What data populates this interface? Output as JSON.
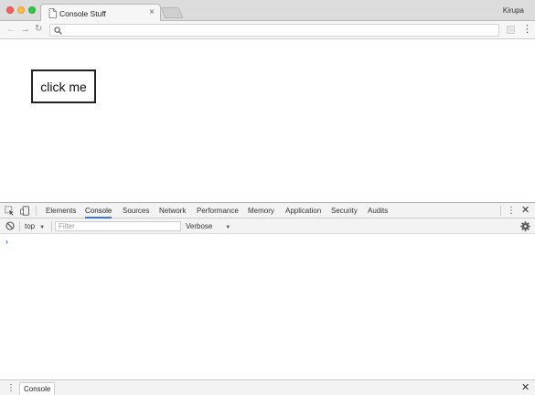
{
  "window": {
    "controls": {
      "close_color": "#fc605c",
      "minimize_color": "#fdbc40",
      "maximize_color": "#34c84a"
    },
    "profile_name": "Kirupa"
  },
  "tabs": [
    {
      "title": "Console Stuff",
      "icon": "document-icon",
      "active": true
    }
  ],
  "toolbar": {
    "back_icon": "arrow-left-icon",
    "forward_icon": "arrow-right-icon",
    "reload_icon": "reload-icon",
    "address_value": "",
    "address_icon": "search-icon",
    "menu_icon": "vertical-dots-icon"
  },
  "page": {
    "button_label": "click me"
  },
  "devtools": {
    "tabs": [
      {
        "label": "Elements"
      },
      {
        "label": "Console",
        "active": true
      },
      {
        "label": "Sources"
      },
      {
        "label": "Network"
      },
      {
        "label": "Performance"
      },
      {
        "label": "Memory"
      },
      {
        "label": "Application"
      },
      {
        "label": "Security"
      },
      {
        "label": "Audits"
      }
    ],
    "accent_color": "#3879d9",
    "console": {
      "context": "top",
      "filter_placeholder": "Filter",
      "filter_value": "",
      "level": "Verbose",
      "prompt_symbol": "›"
    },
    "drawer": {
      "tab_label": "Console"
    }
  }
}
